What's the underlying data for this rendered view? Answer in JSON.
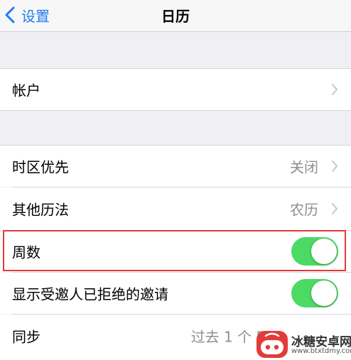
{
  "navbar": {
    "back_label": "设置",
    "title": "日历"
  },
  "rows": {
    "account": {
      "label": "帐户"
    },
    "timezone_override": {
      "label": "时区优先",
      "value": "关闭"
    },
    "alternate_calendars": {
      "label": "其他历法",
      "value": "农历"
    },
    "week_numbers": {
      "label": "周数",
      "toggle_on": true
    },
    "show_declined": {
      "label": "显示受邀人已拒绝的邀请",
      "toggle_on": true
    },
    "sync": {
      "label": "同步",
      "value": "过去 1 个 F"
    }
  },
  "watermark": {
    "title": "冰糖安卓网",
    "url": "www.btxtdmy.com"
  },
  "colors": {
    "accent": "#1f7cf4",
    "toggle_on": "#4cd964",
    "highlight": "#e03a3a",
    "background": "#efeff4"
  }
}
